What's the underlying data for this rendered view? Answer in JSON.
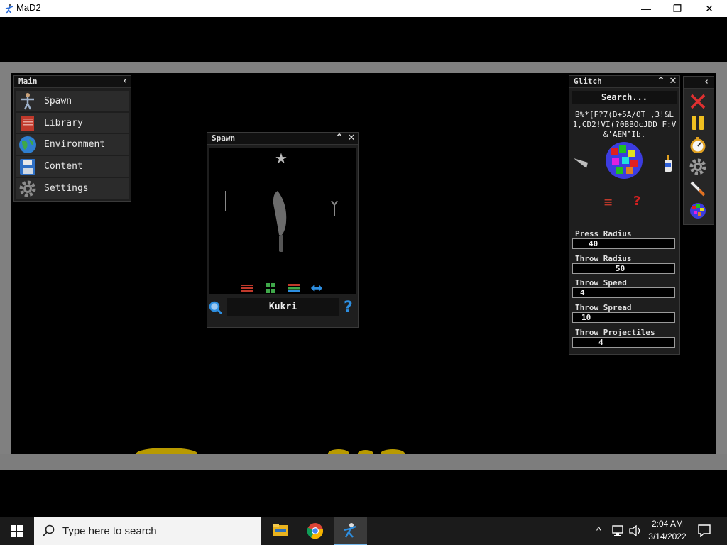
{
  "window": {
    "title": "MaD2",
    "minimize_glyph": "—",
    "restore_glyph": "❐",
    "close_glyph": "✕"
  },
  "main_panel": {
    "title": "Main",
    "collapse_glyph": "‹",
    "items": [
      {
        "label": "Spawn",
        "icon": "person-icon"
      },
      {
        "label": "Library",
        "icon": "book-icon"
      },
      {
        "label": "Environment",
        "icon": "globe-icon"
      },
      {
        "label": "Content",
        "icon": "floppy-icon"
      },
      {
        "label": "Settings",
        "icon": "gear-icon"
      }
    ]
  },
  "spawn_panel": {
    "title": "Spawn",
    "selected_item": "Kukri",
    "favorite_glyph": "★",
    "help_glyph": "?",
    "minimize_glyph": "^",
    "close_glyph": "✕"
  },
  "glitch_panel": {
    "title": "Glitch",
    "search_placeholder": "Search...",
    "glitch_text": "B%*[F?7(D+5A/OT_,3!&L 1,CD2!VI(?0BBOcJDD F:V&'AEM^Ib.",
    "help_glyph": "?",
    "list_glyph": "≡",
    "minimize_glyph": "^",
    "close_glyph": "✕",
    "fields": [
      {
        "label": "Press Radius",
        "value": "40"
      },
      {
        "label": "Throw Radius",
        "value": "50"
      },
      {
        "label": "Throw Speed",
        "value": "4"
      },
      {
        "label": "Throw Spread",
        "value": "10"
      },
      {
        "label": "Throw Projectiles",
        "value": "4"
      }
    ]
  },
  "toolbar": {
    "collapse_glyph": "‹",
    "buttons": [
      "close-x-icon",
      "pause-icon",
      "stopwatch-icon",
      "gear-icon",
      "syringe-icon",
      "glitch-ball-icon"
    ]
  },
  "taskbar": {
    "search_placeholder": "Type here to search",
    "time": "2:04 AM",
    "date": "3/14/2022",
    "tray_chevron": "^"
  },
  "colors": {
    "panel_bg": "#1e1e1e",
    "frame_grey": "#808080",
    "accent_blue": "#2d8ee0"
  }
}
